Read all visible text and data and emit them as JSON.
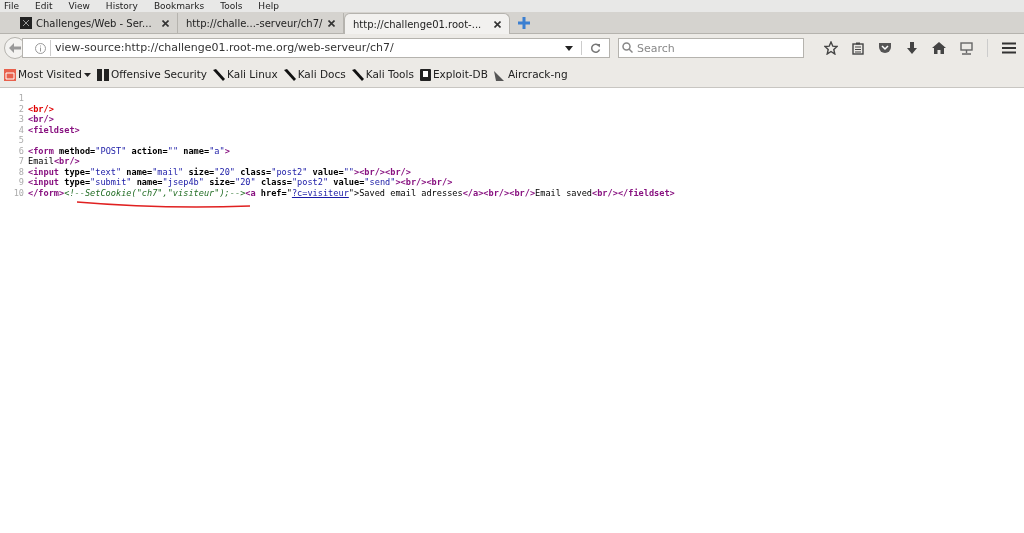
{
  "menu": [
    "File",
    "Edit",
    "View",
    "History",
    "Bookmarks",
    "Tools",
    "Help"
  ],
  "tabs": [
    {
      "label": "Challenges/Web - Ser...",
      "selected": false,
      "has_icon": true
    },
    {
      "label": "http://challe...-serveur/ch7/",
      "selected": false,
      "has_icon": false
    },
    {
      "label": "http://challenge01.root-...",
      "selected": true,
      "has_icon": false
    }
  ],
  "address": {
    "value": "view-source:http://challenge01.root-me.org/web-serveur/ch7/"
  },
  "search": {
    "placeholder": "Search"
  },
  "bookmarks": [
    {
      "label": "Most Visited",
      "kind": "folder"
    },
    {
      "label": "Offensive Security",
      "kind": "offsec"
    },
    {
      "label": "Kali Linux",
      "kind": "kali"
    },
    {
      "label": "Kali Docs",
      "kind": "kali"
    },
    {
      "label": "Kali Tools",
      "kind": "kali"
    },
    {
      "label": "Exploit-DB",
      "kind": "exploit"
    },
    {
      "label": "Aircrack-ng",
      "kind": "aircrack"
    }
  ],
  "source_lines": [
    {
      "number": "1"
    },
    {
      "number": "2",
      "tokens": [
        {
          "kind": "error",
          "text": "<br/>"
        }
      ]
    },
    {
      "number": "3",
      "tokens": [
        {
          "kind": "tag",
          "text": "<br/>"
        }
      ]
    },
    {
      "number": "4",
      "tokens": [
        {
          "kind": "tag",
          "text": "<fieldset>"
        }
      ]
    },
    {
      "number": "5"
    },
    {
      "number": "6",
      "tokens": [
        {
          "kind": "tag",
          "text": "<form"
        },
        {
          "kind": "attr",
          "text": " method="
        },
        {
          "kind": "value",
          "text": "\"POST\""
        },
        {
          "kind": "attr",
          "text": " action="
        },
        {
          "kind": "value",
          "text": "\"\""
        },
        {
          "kind": "attr",
          "text": " name="
        },
        {
          "kind": "value",
          "text": "\"a\""
        },
        {
          "kind": "tag",
          "text": ">"
        }
      ]
    },
    {
      "number": "7",
      "tokens": [
        {
          "kind": "text",
          "text": "Email"
        },
        {
          "kind": "tag",
          "text": "<br/>"
        }
      ]
    },
    {
      "number": "8",
      "tokens": [
        {
          "kind": "tag",
          "text": "<input"
        },
        {
          "kind": "attr",
          "text": " type="
        },
        {
          "kind": "value",
          "text": "\"text\""
        },
        {
          "kind": "attr",
          "text": " name="
        },
        {
          "kind": "value",
          "text": "\"mail\""
        },
        {
          "kind": "attr",
          "text": " size="
        },
        {
          "kind": "value",
          "text": "\"20\""
        },
        {
          "kind": "attr",
          "text": " class="
        },
        {
          "kind": "value",
          "text": "\"post2\""
        },
        {
          "kind": "attr",
          "text": " value="
        },
        {
          "kind": "value",
          "text": "\"\""
        },
        {
          "kind": "tag",
          "text": "><br/><br/>"
        }
      ]
    },
    {
      "number": "9",
      "tokens": [
        {
          "kind": "tag",
          "text": "<input"
        },
        {
          "kind": "attr",
          "text": " type="
        },
        {
          "kind": "value",
          "text": "\"submit\""
        },
        {
          "kind": "attr",
          "text": " name="
        },
        {
          "kind": "value",
          "text": "\"jsep4b\""
        },
        {
          "kind": "attr",
          "text": " size="
        },
        {
          "kind": "value",
          "text": "\"20\""
        },
        {
          "kind": "attr",
          "text": " class="
        },
        {
          "kind": "value",
          "text": "\"post2\""
        },
        {
          "kind": "attr",
          "text": " value="
        },
        {
          "kind": "value",
          "text": "\"send\""
        },
        {
          "kind": "tag",
          "text": "><br/><br/>"
        }
      ]
    },
    {
      "number": "10",
      "tokens": [
        {
          "kind": "tag",
          "text": "</form>"
        },
        {
          "kind": "comment",
          "text": "<!--SetCookie(\"ch7\",\"visiteur\");-->"
        },
        {
          "kind": "tag",
          "text": "<a"
        },
        {
          "kind": "attr",
          "text": " href="
        },
        {
          "kind": "text",
          "text": "\""
        },
        {
          "kind": "link",
          "text": "?c=visiteur"
        },
        {
          "kind": "text",
          "text": "\">Saved email adresses"
        },
        {
          "kind": "tag",
          "text": "</a><br/><br/>"
        },
        {
          "kind": "text",
          "text": "Email saved"
        },
        {
          "kind": "tag",
          "text": "<br/></fieldset>"
        }
      ]
    }
  ]
}
